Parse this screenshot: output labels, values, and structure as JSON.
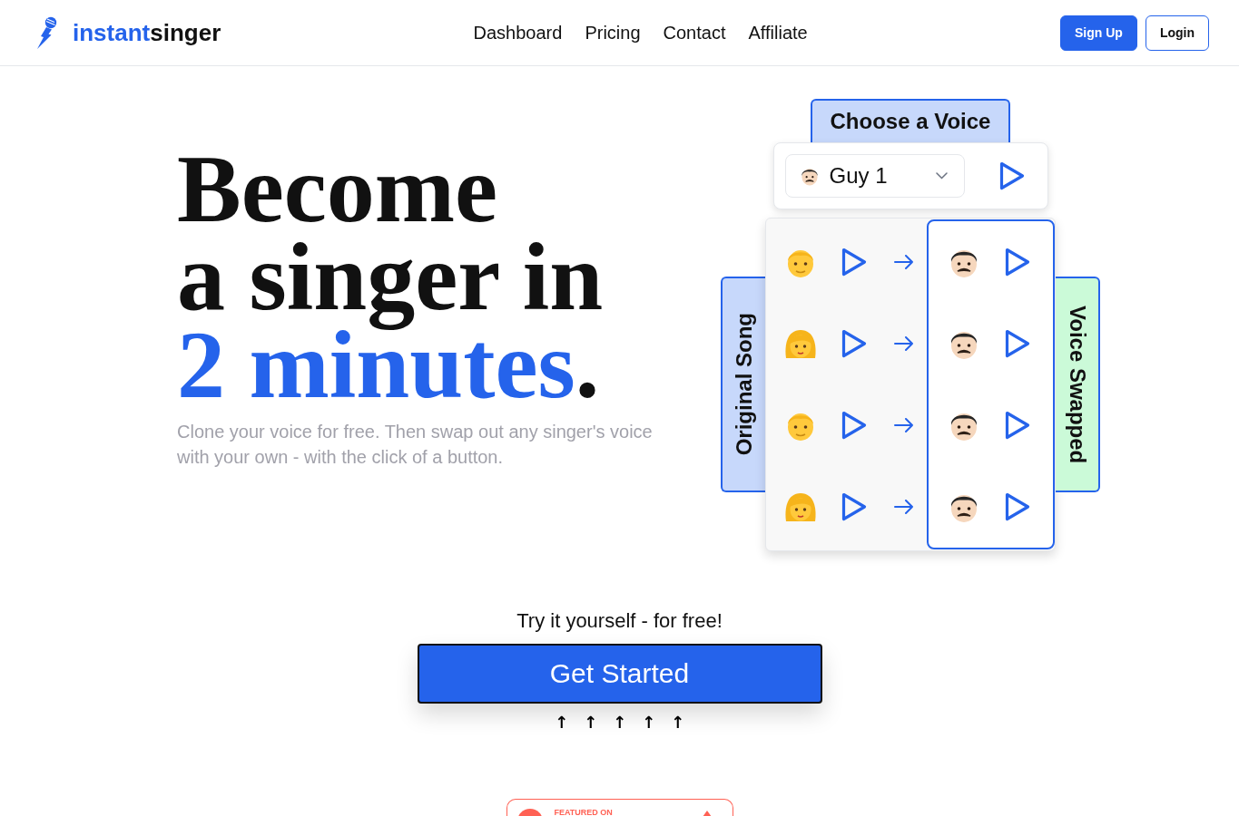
{
  "header": {
    "logo": [
      {
        "text": "instant",
        "accent": true
      },
      {
        "text": "singer",
        "accent": false
      }
    ],
    "nav": [
      "Dashboard",
      "Pricing",
      "Contact",
      "Affiliate"
    ],
    "buttons": [
      {
        "label": "Sign Up",
        "kind": "primary"
      },
      {
        "label": "Login",
        "kind": "outline"
      }
    ]
  },
  "hero": {
    "headline": [
      [
        {
          "text": "Become",
          "accent": false
        }
      ],
      [
        {
          "text": "a singer in",
          "accent": false
        }
      ],
      [
        {
          "text": "2 minutes",
          "accent": true
        },
        {
          "text": ".",
          "accent": false
        }
      ]
    ],
    "subtitle": "Clone your voice for free. Then swap out any singer's voice with your own - with the click of a button."
  },
  "demo": {
    "voice_picker": {
      "title": "Choose a Voice",
      "value": "Guy 1"
    },
    "original_label": "Original Song",
    "swapped_label": "Voice Swapped",
    "rows": [
      {
        "kind": "man"
      },
      {
        "kind": "woman"
      },
      {
        "kind": "man"
      },
      {
        "kind": "woman"
      }
    ]
  },
  "cta": {
    "prompt": "Try it yourself - for free!",
    "button": "Get Started",
    "arrows": [
      "↑",
      "↑",
      "↑",
      "↑",
      "↑"
    ]
  },
  "featured_badge": {
    "label": "FEATURED ON"
  }
}
